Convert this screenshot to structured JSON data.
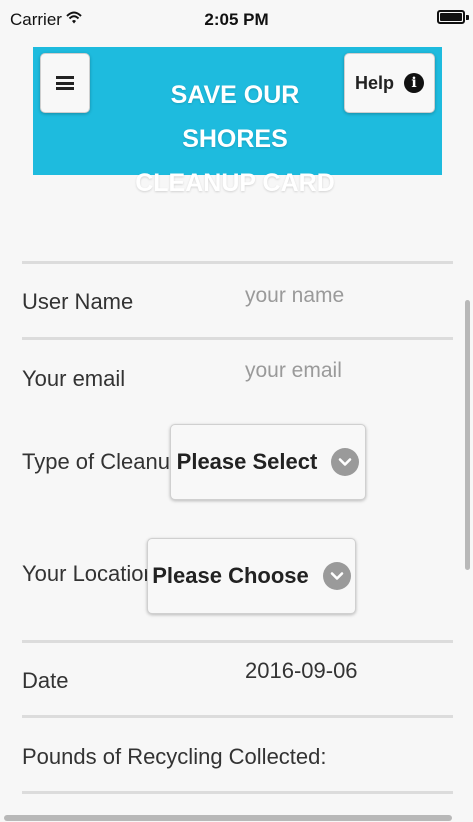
{
  "status_bar": {
    "carrier": "Carrier",
    "time": "2:05 PM"
  },
  "header": {
    "title_line1": "SAVE OUR SHORES",
    "title_line2": "CLEANUP CARD",
    "help_label": "Help",
    "background_color": "#1ebbde",
    "menu_icon": "hamburger-icon",
    "help_icon": "info-icon"
  },
  "form": {
    "user_name": {
      "label": "User Name",
      "placeholder": "your name",
      "value": ""
    },
    "email": {
      "label": "Your email",
      "placeholder": "your email",
      "value": ""
    },
    "cleanup_type": {
      "label": "Type of Cleanup",
      "selected": "Please Select"
    },
    "location": {
      "label": "Your Location",
      "selected": "Please Choose"
    },
    "date": {
      "label": "Date",
      "value": "2016-09-06"
    },
    "recycling": {
      "label": "Pounds of Recycling Collected:"
    }
  }
}
